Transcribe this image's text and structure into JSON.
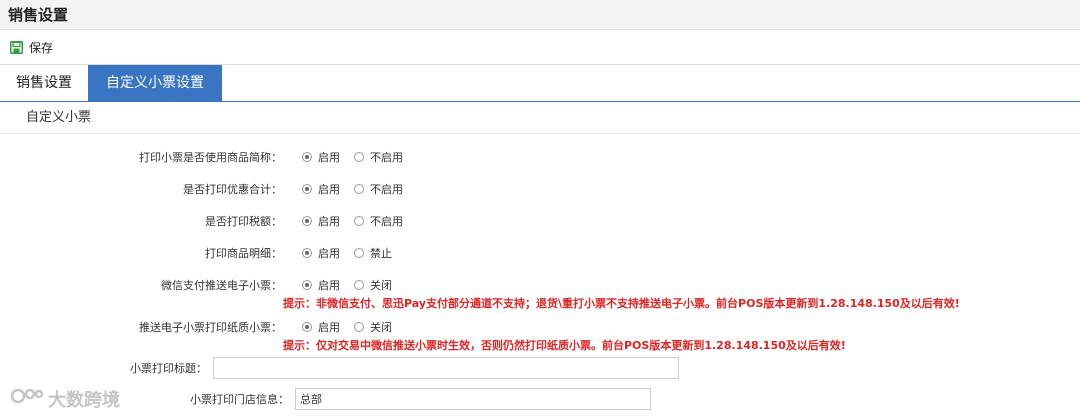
{
  "header": {
    "title": "销售设置"
  },
  "toolbar": {
    "save_label": "保存"
  },
  "tabs": [
    {
      "label": "销售设置",
      "active": false
    },
    {
      "label": "自定义小票设置",
      "active": true
    }
  ],
  "section": {
    "title": "自定义小票"
  },
  "settings": [
    {
      "label": "打印小票是否使用商品简称：",
      "option_on": "启用",
      "option_off": "不启用",
      "selected": "on"
    },
    {
      "label": "是否打印优惠合计：",
      "option_on": "启用",
      "option_off": "不启用",
      "selected": "on"
    },
    {
      "label": "是否打印税额：",
      "option_on": "启用",
      "option_off": "不启用",
      "selected": "on"
    },
    {
      "label": "打印商品明细：",
      "option_on": "启用",
      "option_off": "禁止",
      "selected": "on"
    },
    {
      "label": "微信支付推送电子小票：",
      "option_on": "启用",
      "option_off": "关闭",
      "selected": "on",
      "tip": "提示：非微信支付、思迅Pay支付部分通道不支持；退货\\重打小票不支持推送电子小票。前台POS版本更新到1.28.148.150及以后有效!"
    },
    {
      "label": "推送电子小票打印纸质小票：",
      "option_on": "启用",
      "option_off": "关闭",
      "selected": "on",
      "tip": "提示：仅对交易中微信推送小票时生效，否则仍然打印纸质小票。前台POS版本更新到1.28.148.150及以后有效!"
    }
  ],
  "receipt_title": {
    "label": "小票打印标题：",
    "value": ""
  },
  "store_info": {
    "label": "小票打印门店信息：",
    "value": "总部"
  },
  "watermark": {
    "text": "大数跨境"
  },
  "colors": {
    "accent": "#3a75c4",
    "tip": "#e02424",
    "save_icon": "#2e9e3e"
  }
}
